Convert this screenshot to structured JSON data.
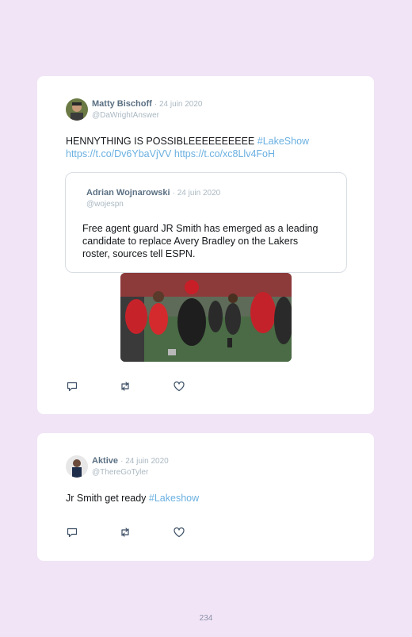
{
  "tweets": [
    {
      "author": "Matty Bischoff",
      "date": "· 24 juin 2020",
      "handle": "@DaWrightAnswer",
      "text": "HENNYTHING IS POSSIBLEEEEEEEEEE ",
      "hashtag": "#LakeShow",
      "link1": "https://t.co/Dv6YbaVjVV",
      "link2": "https://t.co/xc8Llv4FoH",
      "quoted": {
        "author": "Adrian Wojnarowski",
        "date": "· 24 juin 2020",
        "handle": "@wojespn",
        "text": "Free agent guard JR Smith has emerged as a leading candidate to replace Avery Bradley on the Lakers roster, sources tell ESPN."
      },
      "media_icon": "celebration-gif-image",
      "actions": [
        "reply-icon",
        "retweet-icon",
        "like-icon"
      ]
    },
    {
      "author": "Aktive",
      "date": "· 24 juin 2020",
      "handle": "@ThereGoTyler",
      "text": "Jr Smith get ready ",
      "hashtag": "#Lakeshow",
      "actions": [
        "reply-icon",
        "retweet-icon",
        "like-icon"
      ]
    }
  ],
  "page_number": "234",
  "colors": {
    "background": "#f1e4f6",
    "link": "#6ab0e0",
    "name": "#5b7083",
    "meta": "#aab8c2"
  }
}
